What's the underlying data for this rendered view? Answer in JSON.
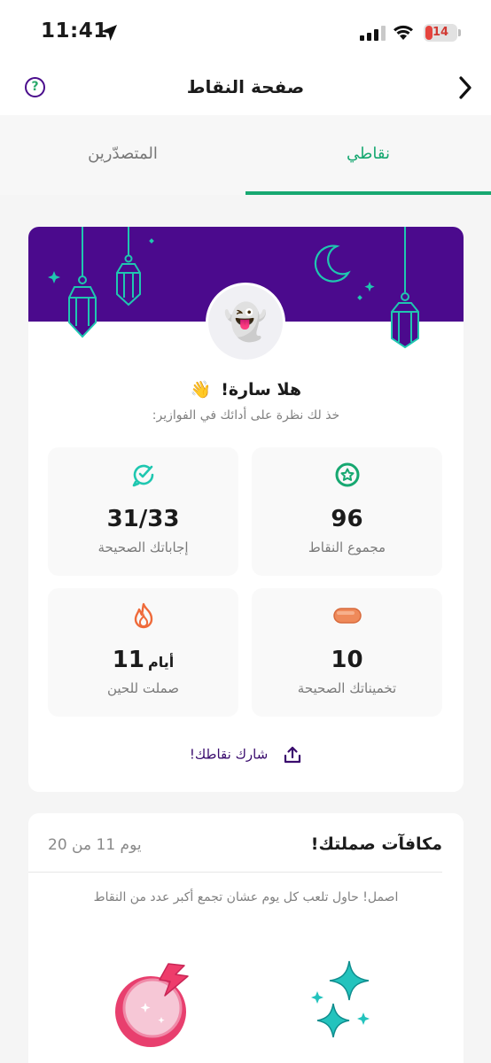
{
  "status_bar": {
    "time": "11:41",
    "battery": "14"
  },
  "header": {
    "title": "صفحة النقاط",
    "help_symbol": "?"
  },
  "tabs": [
    {
      "label": "نقاطي",
      "active": true
    },
    {
      "label": "المتصدّرين",
      "active": false
    }
  ],
  "profile": {
    "avatar_emoji": "👻",
    "greeting": "هلا سارة!",
    "wave_emoji": "👋",
    "subtitle": "خذ لك نظرة على أدائك في الفوازير:"
  },
  "stats": {
    "total_points": {
      "value": "96",
      "label": "مجموع النقاط"
    },
    "correct_answers": {
      "value": "31/33",
      "label": "إجاباتك الصحيحة"
    },
    "correct_guesses": {
      "value": "10",
      "label": "تخميناتك الصحيحة"
    },
    "fasting_streak": {
      "value": "11",
      "unit": "أيام",
      "label": "صملت للحين"
    }
  },
  "share": {
    "label": "شارك نقاطك!"
  },
  "rewards": {
    "title": "مكافآت صملتك!",
    "day": "يوم 11 من 20",
    "hint": "اصمل! حاول تلعب كل يوم عشان تجمع أكبر عدد من النقاط"
  },
  "colors": {
    "accent_green": "#17a871",
    "banner_purple": "#4b0a8d",
    "teal": "#1fc7b0",
    "flame_orange": "#ef6a3a"
  }
}
